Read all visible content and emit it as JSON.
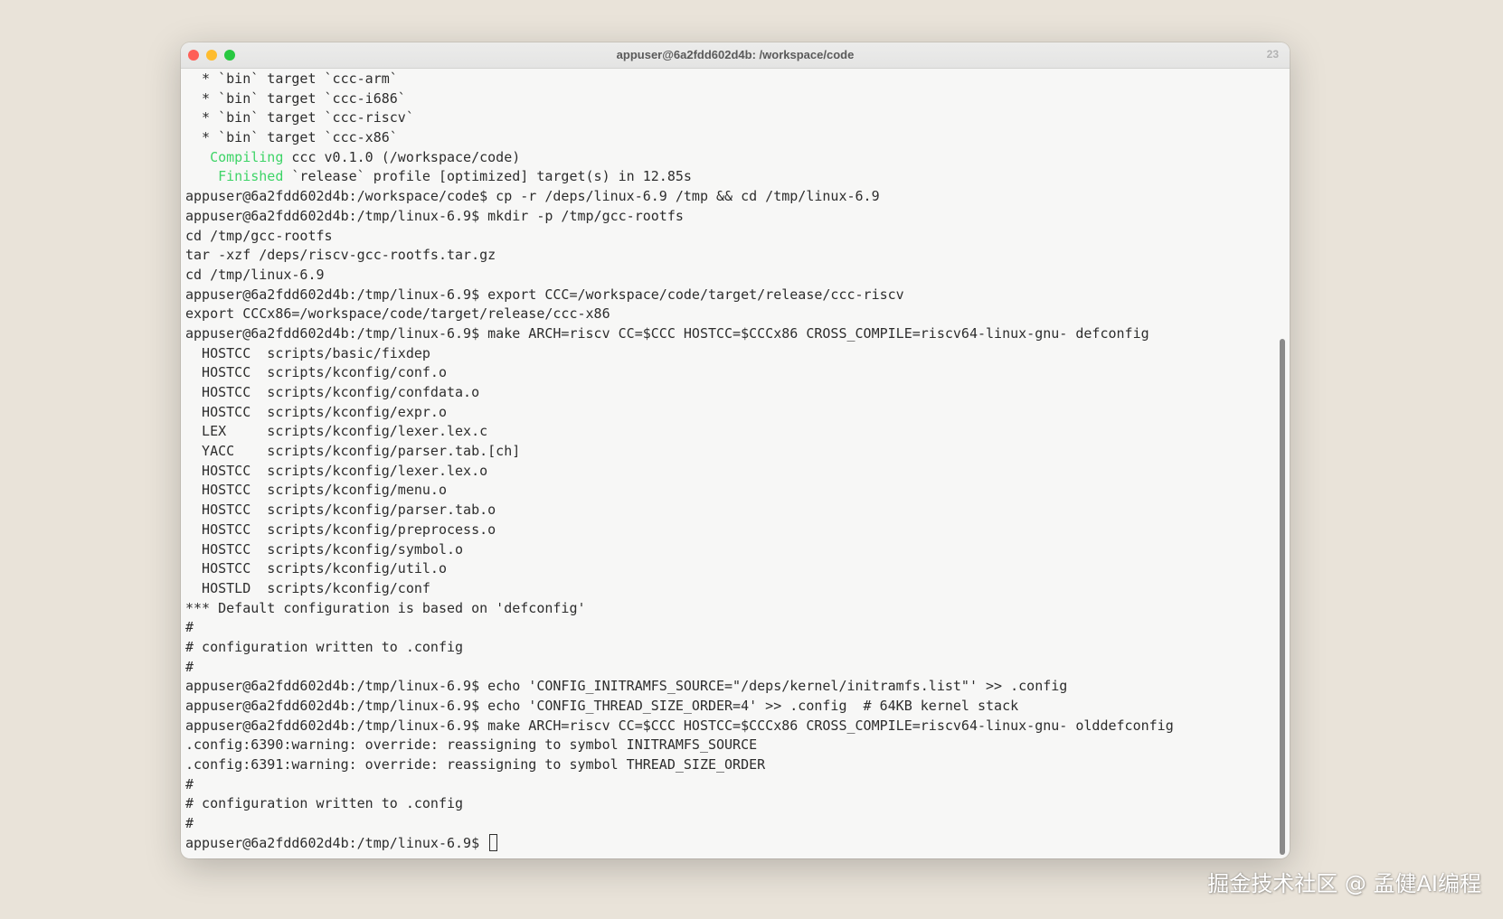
{
  "window": {
    "title": "appuser@6a2fdd602d4b: /workspace/code",
    "badge": "23"
  },
  "terminal": {
    "lines": [
      "  * `bin` target `ccc-arm`",
      "  * `bin` target `ccc-i686`",
      "  * `bin` target `ccc-riscv`",
      "  * `bin` target `ccc-x86`",
      {
        "green": "   Compiling",
        "rest": " ccc v0.1.0 (/workspace/code)"
      },
      {
        "green": "    Finished",
        "rest": " `release` profile [optimized] target(s) in 12.85s"
      },
      "appuser@6a2fdd602d4b:/workspace/code$ cp -r /deps/linux-6.9 /tmp && cd /tmp/linux-6.9",
      "appuser@6a2fdd602d4b:/tmp/linux-6.9$ mkdir -p /tmp/gcc-rootfs",
      "cd /tmp/gcc-rootfs",
      "tar -xzf /deps/riscv-gcc-rootfs.tar.gz",
      "cd /tmp/linux-6.9",
      "appuser@6a2fdd602d4b:/tmp/linux-6.9$ export CCC=/workspace/code/target/release/ccc-riscv",
      "export CCCx86=/workspace/code/target/release/ccc-x86",
      "appuser@6a2fdd602d4b:/tmp/linux-6.9$ make ARCH=riscv CC=$CCC HOSTCC=$CCCx86 CROSS_COMPILE=riscv64-linux-gnu- defconfig",
      "  HOSTCC  scripts/basic/fixdep",
      "  HOSTCC  scripts/kconfig/conf.o",
      "  HOSTCC  scripts/kconfig/confdata.o",
      "  HOSTCC  scripts/kconfig/expr.o",
      "  LEX     scripts/kconfig/lexer.lex.c",
      "  YACC    scripts/kconfig/parser.tab.[ch]",
      "  HOSTCC  scripts/kconfig/lexer.lex.o",
      "  HOSTCC  scripts/kconfig/menu.o",
      "  HOSTCC  scripts/kconfig/parser.tab.o",
      "  HOSTCC  scripts/kconfig/preprocess.o",
      "  HOSTCC  scripts/kconfig/symbol.o",
      "  HOSTCC  scripts/kconfig/util.o",
      "  HOSTLD  scripts/kconfig/conf",
      "*** Default configuration is based on 'defconfig'",
      "#",
      "# configuration written to .config",
      "#",
      "appuser@6a2fdd602d4b:/tmp/linux-6.9$ echo 'CONFIG_INITRAMFS_SOURCE=\"/deps/kernel/initramfs.list\"' >> .config",
      "appuser@6a2fdd602d4b:/tmp/linux-6.9$ echo 'CONFIG_THREAD_SIZE_ORDER=4' >> .config  # 64KB kernel stack",
      "appuser@6a2fdd602d4b:/tmp/linux-6.9$ make ARCH=riscv CC=$CCC HOSTCC=$CCCx86 CROSS_COMPILE=riscv64-linux-gnu- olddefconfig",
      ".config:6390:warning: override: reassigning to symbol INITRAMFS_SOURCE",
      ".config:6391:warning: override: reassigning to symbol THREAD_SIZE_ORDER",
      "#",
      "# configuration written to .config",
      "#"
    ],
    "prompt": "appuser@6a2fdd602d4b:/tmp/linux-6.9$ "
  },
  "watermark": "掘金技术社区 @ 孟健AI编程",
  "colors": {
    "background": "#e9e3d9",
    "terminal_bg": "#f7f7f6",
    "text": "#2d2d2d",
    "cargo_green": "#3ed467"
  }
}
